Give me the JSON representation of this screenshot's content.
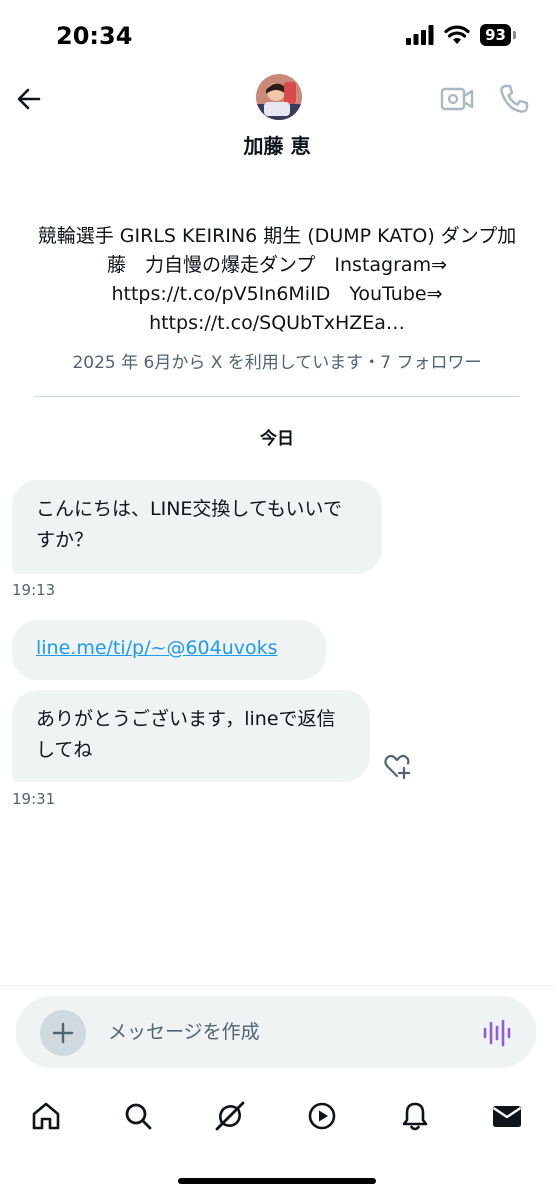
{
  "status_bar": {
    "time": "20:34",
    "battery": "93",
    "icons": [
      "cellular-signal-icon",
      "wifi-icon",
      "battery-icon"
    ]
  },
  "header": {
    "contact_name": "加藤 恵",
    "icons": [
      "back-arrow-icon",
      "avatar",
      "video-camera-icon",
      "phone-icon"
    ]
  },
  "profile": {
    "bio": "競輪選手 GIRLS KEIRIN6 期生 (DUMP KATO) ダンプ加藤　力自慢の爆走ダンプ　Instagram⇒ https://t.co/pV5In6MiID　YouTube⇒ https://t.co/SQUbTxHZEa…",
    "joined": "2025 年 6月から X を利用しています・7 フォロワー"
  },
  "conversation": {
    "date_separator": "今日",
    "messages": [
      {
        "text": "こんにちは、LINE交換してもいいですか？",
        "time": "19:13"
      },
      {
        "text": "line.me/ti/p/~@604uvoks",
        "is_link": true
      },
      {
        "text": "ありがとうございます，lineで返信してね",
        "time": "19:31"
      }
    ]
  },
  "composer": {
    "placeholder": "メッセージを作成"
  },
  "tab_bar": {
    "tabs": [
      "home-icon",
      "search-icon",
      "grok-icon",
      "video-icon",
      "notifications-icon",
      "messages-icon"
    ],
    "active": "messages-icon"
  },
  "colors": {
    "link": "#1d9bf0",
    "bubble": "#eff3f4",
    "secondary_text": "#536471",
    "header_icon": "#aab8c2",
    "voice_icon": "#8c5fd9"
  }
}
